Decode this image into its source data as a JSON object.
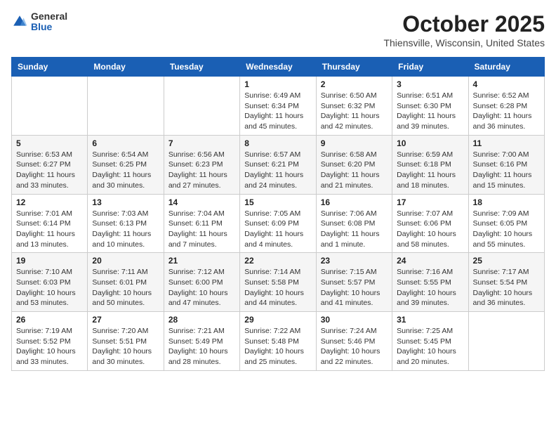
{
  "header": {
    "logo_general": "General",
    "logo_blue": "Blue",
    "month_title": "October 2025",
    "location": "Thiensville, Wisconsin, United States"
  },
  "days_of_week": [
    "Sunday",
    "Monday",
    "Tuesday",
    "Wednesday",
    "Thursday",
    "Friday",
    "Saturday"
  ],
  "weeks": [
    [
      {
        "day": "",
        "info": ""
      },
      {
        "day": "",
        "info": ""
      },
      {
        "day": "",
        "info": ""
      },
      {
        "day": "1",
        "info": "Sunrise: 6:49 AM\nSunset: 6:34 PM\nDaylight: 11 hours\nand 45 minutes."
      },
      {
        "day": "2",
        "info": "Sunrise: 6:50 AM\nSunset: 6:32 PM\nDaylight: 11 hours\nand 42 minutes."
      },
      {
        "day": "3",
        "info": "Sunrise: 6:51 AM\nSunset: 6:30 PM\nDaylight: 11 hours\nand 39 minutes."
      },
      {
        "day": "4",
        "info": "Sunrise: 6:52 AM\nSunset: 6:28 PM\nDaylight: 11 hours\nand 36 minutes."
      }
    ],
    [
      {
        "day": "5",
        "info": "Sunrise: 6:53 AM\nSunset: 6:27 PM\nDaylight: 11 hours\nand 33 minutes."
      },
      {
        "day": "6",
        "info": "Sunrise: 6:54 AM\nSunset: 6:25 PM\nDaylight: 11 hours\nand 30 minutes."
      },
      {
        "day": "7",
        "info": "Sunrise: 6:56 AM\nSunset: 6:23 PM\nDaylight: 11 hours\nand 27 minutes."
      },
      {
        "day": "8",
        "info": "Sunrise: 6:57 AM\nSunset: 6:21 PM\nDaylight: 11 hours\nand 24 minutes."
      },
      {
        "day": "9",
        "info": "Sunrise: 6:58 AM\nSunset: 6:20 PM\nDaylight: 11 hours\nand 21 minutes."
      },
      {
        "day": "10",
        "info": "Sunrise: 6:59 AM\nSunset: 6:18 PM\nDaylight: 11 hours\nand 18 minutes."
      },
      {
        "day": "11",
        "info": "Sunrise: 7:00 AM\nSunset: 6:16 PM\nDaylight: 11 hours\nand 15 minutes."
      }
    ],
    [
      {
        "day": "12",
        "info": "Sunrise: 7:01 AM\nSunset: 6:14 PM\nDaylight: 11 hours\nand 13 minutes."
      },
      {
        "day": "13",
        "info": "Sunrise: 7:03 AM\nSunset: 6:13 PM\nDaylight: 11 hours\nand 10 minutes."
      },
      {
        "day": "14",
        "info": "Sunrise: 7:04 AM\nSunset: 6:11 PM\nDaylight: 11 hours\nand 7 minutes."
      },
      {
        "day": "15",
        "info": "Sunrise: 7:05 AM\nSunset: 6:09 PM\nDaylight: 11 hours\nand 4 minutes."
      },
      {
        "day": "16",
        "info": "Sunrise: 7:06 AM\nSunset: 6:08 PM\nDaylight: 11 hours\nand 1 minute."
      },
      {
        "day": "17",
        "info": "Sunrise: 7:07 AM\nSunset: 6:06 PM\nDaylight: 10 hours\nand 58 minutes."
      },
      {
        "day": "18",
        "info": "Sunrise: 7:09 AM\nSunset: 6:05 PM\nDaylight: 10 hours\nand 55 minutes."
      }
    ],
    [
      {
        "day": "19",
        "info": "Sunrise: 7:10 AM\nSunset: 6:03 PM\nDaylight: 10 hours\nand 53 minutes."
      },
      {
        "day": "20",
        "info": "Sunrise: 7:11 AM\nSunset: 6:01 PM\nDaylight: 10 hours\nand 50 minutes."
      },
      {
        "day": "21",
        "info": "Sunrise: 7:12 AM\nSunset: 6:00 PM\nDaylight: 10 hours\nand 47 minutes."
      },
      {
        "day": "22",
        "info": "Sunrise: 7:14 AM\nSunset: 5:58 PM\nDaylight: 10 hours\nand 44 minutes."
      },
      {
        "day": "23",
        "info": "Sunrise: 7:15 AM\nSunset: 5:57 PM\nDaylight: 10 hours\nand 41 minutes."
      },
      {
        "day": "24",
        "info": "Sunrise: 7:16 AM\nSunset: 5:55 PM\nDaylight: 10 hours\nand 39 minutes."
      },
      {
        "day": "25",
        "info": "Sunrise: 7:17 AM\nSunset: 5:54 PM\nDaylight: 10 hours\nand 36 minutes."
      }
    ],
    [
      {
        "day": "26",
        "info": "Sunrise: 7:19 AM\nSunset: 5:52 PM\nDaylight: 10 hours\nand 33 minutes."
      },
      {
        "day": "27",
        "info": "Sunrise: 7:20 AM\nSunset: 5:51 PM\nDaylight: 10 hours\nand 30 minutes."
      },
      {
        "day": "28",
        "info": "Sunrise: 7:21 AM\nSunset: 5:49 PM\nDaylight: 10 hours\nand 28 minutes."
      },
      {
        "day": "29",
        "info": "Sunrise: 7:22 AM\nSunset: 5:48 PM\nDaylight: 10 hours\nand 25 minutes."
      },
      {
        "day": "30",
        "info": "Sunrise: 7:24 AM\nSunset: 5:46 PM\nDaylight: 10 hours\nand 22 minutes."
      },
      {
        "day": "31",
        "info": "Sunrise: 7:25 AM\nSunset: 5:45 PM\nDaylight: 10 hours\nand 20 minutes."
      },
      {
        "day": "",
        "info": ""
      }
    ]
  ]
}
